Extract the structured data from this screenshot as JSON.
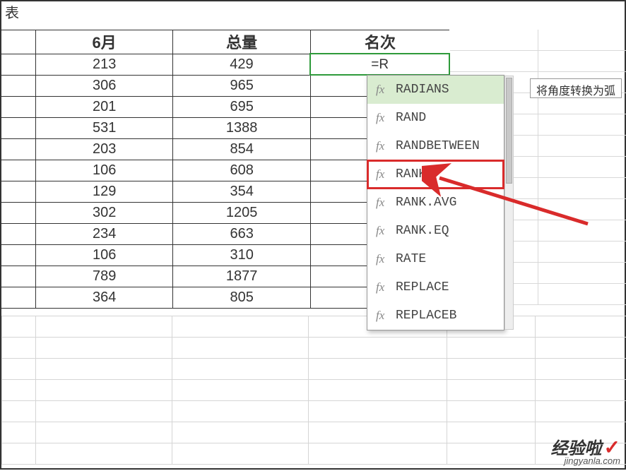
{
  "title_fragment": "表",
  "headers": {
    "col1": "6月",
    "col2": "总量",
    "col3": "名次"
  },
  "active_formula": "=R",
  "rows": [
    {
      "a": "213",
      "b": "429"
    },
    {
      "a": "306",
      "b": "965"
    },
    {
      "a": "201",
      "b": "695"
    },
    {
      "a": "531",
      "b": "1388"
    },
    {
      "a": "203",
      "b": "854"
    },
    {
      "a": "106",
      "b": "608"
    },
    {
      "a": "129",
      "b": "354"
    },
    {
      "a": "302",
      "b": "1205"
    },
    {
      "a": "234",
      "b": "663"
    },
    {
      "a": "106",
      "b": "310"
    },
    {
      "a": "789",
      "b": "1877"
    },
    {
      "a": "364",
      "b": "805"
    }
  ],
  "dropdown": {
    "items": [
      {
        "label": "RADIANS",
        "highlighted": true,
        "boxed": false
      },
      {
        "label": "RAND",
        "highlighted": false,
        "boxed": false
      },
      {
        "label": "RANDBETWEEN",
        "highlighted": false,
        "boxed": false
      },
      {
        "label": "RANK",
        "highlighted": false,
        "boxed": true
      },
      {
        "label": "RANK.AVG",
        "highlighted": false,
        "boxed": false
      },
      {
        "label": "RANK.EQ",
        "highlighted": false,
        "boxed": false
      },
      {
        "label": "RATE",
        "highlighted": false,
        "boxed": false
      },
      {
        "label": "REPLACE",
        "highlighted": false,
        "boxed": false
      },
      {
        "label": "REPLACEB",
        "highlighted": false,
        "boxed": false
      }
    ]
  },
  "tooltip": "将角度转换为弧",
  "fx_glyph": "fx",
  "watermark": {
    "main": "经验啦",
    "check": "✓",
    "sub": "jingyanla.com"
  }
}
